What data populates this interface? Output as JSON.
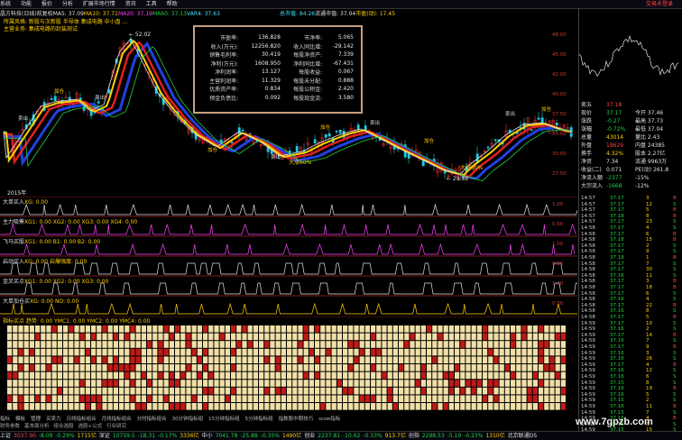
{
  "menu": {
    "items": [
      "系统",
      "功能",
      "报价",
      "分析",
      "扩展市场行情",
      "资讯",
      "工具",
      "帮助"
    ],
    "right_text": "交易未登录"
  },
  "title": {
    "name": "晶方科技(日线)前复权",
    "ma": [
      {
        "text": "MA5: 37.09",
        "color": "#e0e0e0"
      },
      {
        "text": "MA10: 37.71",
        "color": "#ffd000"
      },
      {
        "text": "MA20: 37.19",
        "color": "#ff40ff"
      },
      {
        "text": "MA60: 37.13",
        "color": "#20d040"
      },
      {
        "text": "VAR4: 37.63",
        "color": "#40e0ff"
      }
    ],
    "extra": [
      {
        "text": "总市值: 84.26",
        "color": "#40e0ff"
      },
      {
        "text": "流通市值: 37.04",
        "color": "#e0e0e0"
      },
      {
        "text": "市盈(动): 17.45",
        "color": "#ffd000"
      }
    ]
  },
  "annotations": [
    "所属风格: 新股与次新股 半导体 集成电路 中小盘 ...",
    "主营业务: 集成电路的封装测试"
  ],
  "infobox": {
    "rows": [
      [
        "市盈率:",
        "136.828",
        "市净率:",
        "5.065"
      ],
      [
        "收入(万元):",
        "12256.820",
        "收入同比增:",
        "-29.142"
      ],
      [
        "销售毛利率:",
        "30.419",
        "每股净资产:",
        "7.339"
      ],
      [
        "净利(万元):",
        "1608.950",
        "净利同比增:",
        "-67.431"
      ],
      [
        "净利润率:",
        "13.127",
        "每股收益:",
        "0.067"
      ],
      [
        "主营利润率:",
        "11.329",
        "每股未分配:",
        "0.888"
      ],
      [
        "优质资产率:",
        "0.834",
        "每股公积金:",
        "2.420"
      ],
      [
        "预金负债比:",
        "0.092",
        "每股现金流:",
        "3.580"
      ]
    ]
  },
  "chart_labels": {
    "peak": "52.02",
    "low": "29.38",
    "buy": "加仓",
    "fill": "卖出",
    "pct": "大涨60%"
  },
  "panels": [
    {
      "label": "大单买入",
      "values": "XG: 0.00",
      "color": "#ffd000"
    },
    {
      "label": "主力吸筹",
      "values": "XG1: 0.00  XG2: 0.00  XG3: 0.00  XG4: 0.00",
      "color": "#ffd000"
    },
    {
      "label": "飞马买股",
      "values": "XG1: 0.00  B1: 0.00  B2: 0.00",
      "color": "#ffd000"
    },
    {
      "label": "启动买入",
      "values": "XG: 0.00  启爆强度: 0.00",
      "color": "#ffd000"
    },
    {
      "label": "金叉买点",
      "values": "XG1: 0.00  XG2: 0.00  XG3: 0.00",
      "color": "#ffd000"
    },
    {
      "label": "大单加仓买",
      "values": "XG: 0.00  NO: 0.00",
      "color": "#ffd000"
    },
    {
      "label": "指标买点",
      "values": "趋势: 0.00  YMC1: 0.00  YMC2: 0.00  YMC4: 0.00",
      "color": "#ffd000"
    }
  ],
  "yaxis": {
    "main": [
      "48.00",
      "45.00",
      "42.00",
      "40.00",
      "37.50",
      "35.00",
      "30.00",
      "27.50"
    ],
    "panel": [
      "1.00",
      "0.50",
      "1.00",
      "0.50",
      "1.00",
      "0.50",
      "1.00",
      "0.50"
    ]
  },
  "right_panel": {
    "quote": [
      {
        "k": "卖五",
        "v": "37.18",
        "c": "#ff4040",
        "n": ""
      },
      {
        "k": "现价",
        "v": "37.17",
        "c": "#20d040",
        "n": "今开 37.46"
      },
      {
        "k": "涨跌",
        "v": "-0.27",
        "c": "#20d040",
        "n": "最高 37.73"
      },
      {
        "k": "涨幅",
        "v": "-0.72%",
        "c": "#20d040",
        "n": "最低 37.04"
      },
      {
        "k": "总量",
        "v": "43014",
        "c": "#ffd000",
        "n": "量比 2.43"
      },
      {
        "k": "外盘",
        "v": "18629",
        "c": "#ff4040",
        "n": "内盘 24385"
      },
      {
        "k": "换手",
        "v": "4.32%",
        "c": "#ffd000",
        "n": "股本 2.27亿"
      },
      {
        "k": "净资",
        "v": "7.34",
        "c": "#e0e0e0",
        "n": "流通 9963万"
      },
      {
        "k": "收益(二)",
        "v": "0.071",
        "c": "#e0e0e0",
        "n": "PE(动) 261.8"
      },
      {
        "k": "净流入额",
        "v": "-2377",
        "c": "#20d040",
        "n": "-15%"
      },
      {
        "k": "大宗流入",
        "v": "-1668",
        "c": "#20d040",
        "n": "-12%"
      }
    ],
    "ticks": [
      [
        "14:57",
        "37.17",
        "3",
        "B"
      ],
      [
        "14:57",
        "37.17",
        "12",
        "S"
      ],
      [
        "14:57",
        "37.17",
        "5",
        "B"
      ],
      [
        "14:57",
        "37.18",
        "8",
        "B"
      ],
      [
        "14:57",
        "37.17",
        "23",
        "S"
      ],
      [
        "14:58",
        "37.17",
        "4",
        "S"
      ],
      [
        "14:58",
        "37.17",
        "6",
        "B"
      ],
      [
        "14:58",
        "37.18",
        "15",
        "B"
      ],
      [
        "14:58",
        "37.17",
        "2",
        "S"
      ],
      [
        "14:58",
        "37.17",
        "9",
        "S"
      ],
      [
        "14:58",
        "37.18",
        "1",
        "B"
      ],
      [
        "14:58",
        "37.17",
        "7",
        "S"
      ],
      [
        "14:58",
        "37.17",
        "30",
        "S"
      ],
      [
        "14:58",
        "37.16",
        "11",
        "S"
      ],
      [
        "14:58",
        "37.17",
        "3",
        "B"
      ],
      [
        "14:58",
        "37.17",
        "18",
        "B"
      ],
      [
        "14:58",
        "37.17",
        "6",
        "S"
      ],
      [
        "14:58",
        "37.16",
        "4",
        "S"
      ],
      [
        "14:58",
        "37.17",
        "22",
        "B"
      ],
      [
        "14:58",
        "37.16",
        "8",
        "S"
      ],
      [
        "14:58",
        "37.17",
        "5",
        "B"
      ],
      [
        "14:59",
        "37.17",
        "10",
        "S"
      ],
      [
        "14:59",
        "37.16",
        "2",
        "S"
      ],
      [
        "14:59",
        "37.17",
        "14",
        "B"
      ],
      [
        "14:59",
        "37.16",
        "7",
        "S"
      ],
      [
        "14:59",
        "37.17",
        "9",
        "B"
      ],
      [
        "14:59",
        "37.16",
        "3",
        "S"
      ],
      [
        "14:59",
        "37.16",
        "26",
        "S"
      ],
      [
        "14:59",
        "37.17",
        "4",
        "B"
      ],
      [
        "14:59",
        "37.16",
        "12",
        "S"
      ],
      [
        "14:59",
        "37.16",
        "6",
        "S"
      ],
      [
        "14:59",
        "37.15",
        "8",
        "S"
      ],
      [
        "14:59",
        "37.16",
        "19",
        "B"
      ],
      [
        "14:59",
        "37.16",
        "5",
        "S"
      ],
      [
        "14:59",
        "37.15",
        "2",
        "S"
      ],
      [
        "14:59",
        "37.16",
        "11",
        "B"
      ],
      [
        "14:59",
        "37.15",
        "7",
        "S"
      ],
      [
        "14:59",
        "37.16",
        "4",
        "B"
      ],
      [
        "14:59",
        "37.15",
        "3",
        "S"
      ],
      [
        "14:59",
        "37.15",
        "15",
        "S"
      ],
      [
        "14:59",
        "37.15",
        "6",
        "S"
      ]
    ]
  },
  "bottom_tabs": [
    "指标",
    "模板",
    "管理",
    "买卖力",
    "日线指标组合",
    "月线指标组合",
    "分时指标组合",
    "30分钟指标组",
    "15分钟指标组",
    "5分钟指标组",
    "指数股中期技巧",
    "scsw指标"
  ],
  "bottom_tabs2": [
    "财务参数",
    "基本面分析",
    "组合选股",
    "选股+公式",
    "行业研究"
  ],
  "status": [
    {
      "text": "上证",
      "c": "#e0e0e0"
    },
    {
      "text": "3037.90",
      "c": "#ff4040"
    },
    {
      "text": "-8.09",
      "c": "#20d040"
    },
    {
      "text": "-0.29%",
      "c": "#20d040"
    },
    {
      "text": "1715亿",
      "c": "#ffd000"
    },
    {
      "text": "深证",
      "c": "#e0e0e0"
    },
    {
      "text": "10759.5",
      "c": "#20d040"
    },
    {
      "text": "-18.31",
      "c": "#20d040"
    },
    {
      "text": "-0.17%",
      "c": "#20d040"
    },
    {
      "text": "3336亿",
      "c": "#ffd000"
    },
    {
      "text": "中小",
      "c": "#e0e0e0"
    },
    {
      "text": "7041.78",
      "c": "#20d040"
    },
    {
      "text": "-25.88",
      "c": "#20d040"
    },
    {
      "text": "-0.35%",
      "c": "#20d040"
    },
    {
      "text": "1490亿",
      "c": "#ffd000"
    },
    {
      "text": "创业",
      "c": "#e0e0e0"
    },
    {
      "text": "2237.81",
      "c": "#20d040"
    },
    {
      "text": "-10.62",
      "c": "#20d040"
    },
    {
      "text": "-0.33%",
      "c": "#20d040"
    },
    {
      "text": "913.7亿",
      "c": "#ffd000"
    },
    {
      "text": "创指",
      "c": "#e0e0e0"
    },
    {
      "text": "2288.53",
      "c": "#20d040"
    },
    {
      "text": "-5.19",
      "c": "#20d040"
    },
    {
      "text": "-0.23%",
      "c": "#20d040"
    },
    {
      "text": "1310亿",
      "c": "#ffd000"
    },
    {
      "text": "北京联通DS",
      "c": "#e0e0e0"
    }
  ],
  "watermark": "www.7gpzb.com",
  "year_label": "2015年",
  "colors": {
    "up": "#ff3030",
    "down": "#20c8e0",
    "panel_border": "#7a1a1a",
    "grid_cell": "#f0e0a8",
    "grid_red": "#c01818"
  }
}
